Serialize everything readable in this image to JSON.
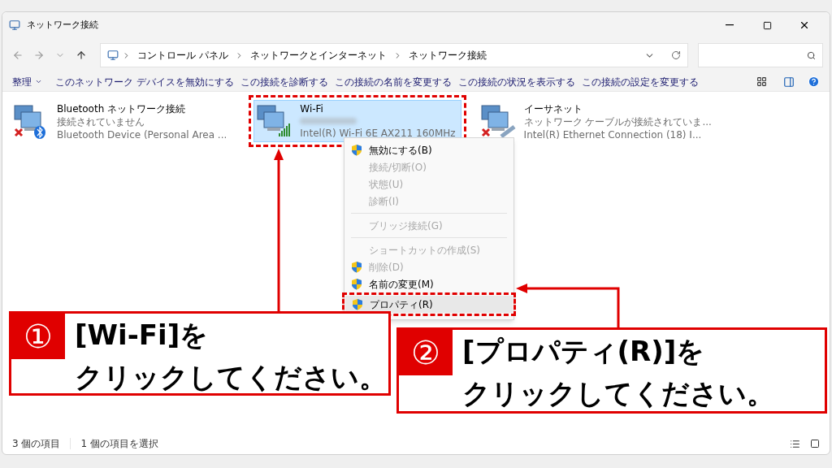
{
  "window": {
    "title": "ネットワーク接続"
  },
  "address_bar": {
    "path": [
      "コントロール パネル",
      "ネットワークとインターネット",
      "ネットワーク接続"
    ]
  },
  "command_bar": {
    "organize": "整理",
    "commands": [
      "このネットワーク デバイスを無効にする",
      "この接続を診断する",
      "この接続の名前を変更する",
      "この接続の状況を表示する",
      "この接続の設定を変更する"
    ]
  },
  "connections": [
    {
      "kind": "bluetooth",
      "name": "Bluetooth ネットワーク接続",
      "status": "接続されていません",
      "device": "Bluetooth Device (Personal Area ...",
      "selected": false
    },
    {
      "kind": "wifi",
      "name": "Wi-Fi",
      "device": "Intel(R) Wi-Fi 6E AX211 160MHz",
      "selected": true
    },
    {
      "kind": "ethernet",
      "name": "イーサネット",
      "status": "ネットワーク ケーブルが接続されていま...",
      "device": "Intel(R) Ethernet Connection (18) I...",
      "selected": false
    }
  ],
  "context_menu": {
    "items": [
      {
        "kind": "item",
        "label": "無効にする(B)",
        "shield": true,
        "disabled": false,
        "selected": false
      },
      {
        "kind": "item",
        "label": "接続/切断(O)",
        "shield": false,
        "disabled": true,
        "selected": false
      },
      {
        "kind": "item",
        "label": "状態(U)",
        "shield": false,
        "disabled": true,
        "selected": false
      },
      {
        "kind": "item",
        "label": "診断(I)",
        "shield": false,
        "disabled": true,
        "selected": false
      },
      {
        "kind": "separator"
      },
      {
        "kind": "item",
        "label": "ブリッジ接続(G)",
        "shield": false,
        "disabled": true,
        "selected": false
      },
      {
        "kind": "separator"
      },
      {
        "kind": "item",
        "label": "ショートカットの作成(S)",
        "shield": false,
        "disabled": true,
        "selected": false
      },
      {
        "kind": "item",
        "label": "削除(D)",
        "shield": true,
        "disabled": true,
        "selected": false
      },
      {
        "kind": "item",
        "label": "名前の変更(M)",
        "shield": true,
        "disabled": false,
        "selected": false
      },
      {
        "kind": "item",
        "label": "プロパティ(R)",
        "shield": true,
        "disabled": false,
        "selected": true
      }
    ]
  },
  "callouts": [
    {
      "number": "①",
      "lines": [
        "[Wi-Fi]を",
        "クリックしてください。"
      ]
    },
    {
      "number": "②",
      "lines": [
        "[プロパティ(R)]を",
        "クリックしてください。"
      ]
    }
  ],
  "status_bar": {
    "count": "3 個の項目",
    "selection": "1 個の項目を選択"
  }
}
